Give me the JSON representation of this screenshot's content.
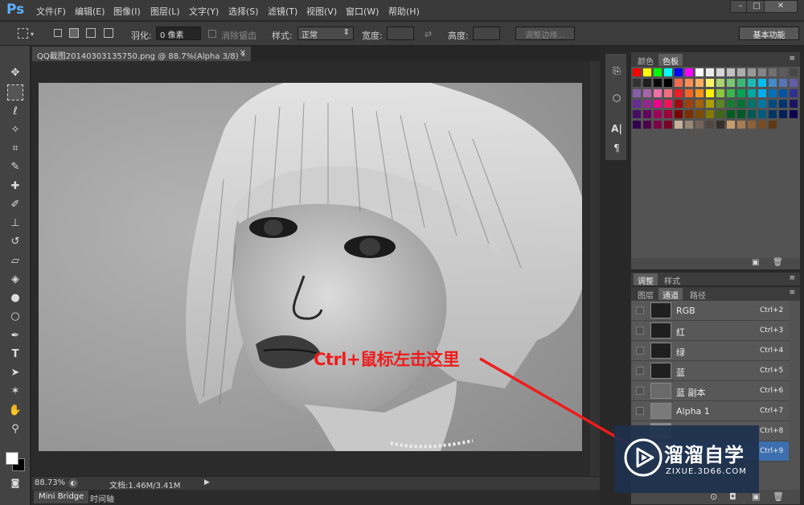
{
  "app": {
    "logo": "Ps"
  },
  "menu": [
    "文件(F)",
    "编辑(E)",
    "图像(I)",
    "图层(L)",
    "文字(Y)",
    "选择(S)",
    "滤镜(T)",
    "视图(V)",
    "窗口(W)",
    "帮助(H)"
  ],
  "window_controls": {
    "minimize": "–",
    "maximize": "□",
    "close": "✕"
  },
  "options": {
    "feather_label": "羽化:",
    "feather_value": "0 像素",
    "antialias_label": "消除锯齿",
    "style_label": "样式:",
    "style_value": "正常",
    "width_label": "宽度:",
    "height_label": "高度:",
    "refine_edge_label": "调整边缘...",
    "workspace_label": "基本功能"
  },
  "document": {
    "tab_title": "QQ截图20140303135750.png @ 88.7%(Alpha 3/8) *",
    "close_glyph": "×",
    "zoom": "88.73%",
    "doc_info": "文档:1.46M/3.41M"
  },
  "bottom_tabs": [
    "Mini Bridge",
    "时间轴"
  ],
  "panels": {
    "color_tabs": [
      "颜色",
      "色板"
    ],
    "adjust_tabs": [
      "调整",
      "样式"
    ],
    "layer_tabs": [
      "图层",
      "通道",
      "路径"
    ]
  },
  "channels": [
    {
      "name": "RGB",
      "shortcut": "Ctrl+2"
    },
    {
      "name": "红",
      "shortcut": "Ctrl+3"
    },
    {
      "name": "绿",
      "shortcut": "Ctrl+4"
    },
    {
      "name": "蓝",
      "shortcut": "Ctrl+5"
    },
    {
      "name": "蓝 副本",
      "shortcut": "Ctrl+6"
    },
    {
      "name": "Alpha 1",
      "shortcut": "Ctrl+7"
    },
    {
      "name": "",
      "shortcut": "Ctrl+8"
    },
    {
      "name": "",
      "shortcut": "Ctrl+9"
    }
  ],
  "annotation": {
    "text": "Ctrl+鼠标左击这里",
    "color": "#ee1c1c"
  },
  "watermark": {
    "brand": "溜溜自学",
    "url": "ZIXUE.3D66.COM"
  },
  "colors": {
    "accent": "#5cb1ff",
    "annotation": "#ee1c1c",
    "panel": "#535353"
  }
}
